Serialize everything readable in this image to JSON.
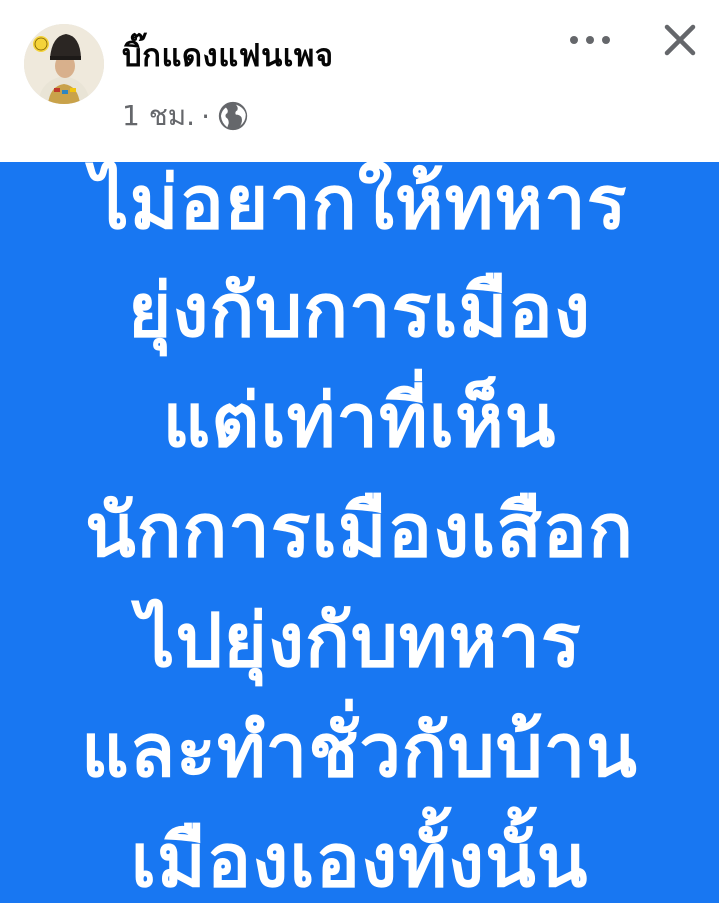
{
  "post": {
    "author_name": "บิ๊กแดงแฟนเพจ",
    "time": "1 ชม.",
    "separator": "·",
    "privacy_icon": "globe-icon",
    "more_icon": "more-horizontal-icon",
    "close_icon": "close-icon",
    "background_color": "#1877f2",
    "text_color": "#ffffff",
    "text_lines": [
      "ไม่อยากให้ทหาร",
      "ยุ่งกับการเมือง",
      "แต่เท่าที่เห็น",
      "นักการเมืองเสือก",
      "ไปยุ่งกับทหาร",
      "และทำชั่วกับบ้าน",
      "เมืองเองทั้งนั้น"
    ]
  }
}
